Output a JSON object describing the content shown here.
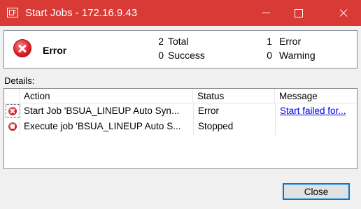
{
  "window": {
    "title": "Start Jobs - 172.16.9.43",
    "controls": {
      "minimize_icon": "minimize-icon",
      "maximize_icon": "maximize-icon",
      "close_icon": "close-icon"
    }
  },
  "summary": {
    "status": "Error",
    "icon": "error-icon",
    "total_count": "2",
    "total_label": "Total",
    "success_count": "0",
    "success_label": "Success",
    "error_count": "1",
    "error_label": "Error",
    "warning_count": "0",
    "warning_label": "Warning"
  },
  "details": {
    "label": "Details:",
    "columns": [
      "Action",
      "Status",
      "Message"
    ],
    "rows": [
      {
        "icon": "error-icon",
        "action": "Start Job 'BSUA_LINEUP Auto Syn...",
        "status": "Error",
        "message": "Start failed for..."
      },
      {
        "icon": "stopped-icon",
        "action": "Execute job 'BSUA_LINEUP Auto S...",
        "status": "Stopped",
        "message": ""
      }
    ]
  },
  "buttons": {
    "close_label": "Close"
  },
  "colors": {
    "titlebar": "#d93a35",
    "accent": "#0078d7",
    "link": "#0000ee"
  }
}
